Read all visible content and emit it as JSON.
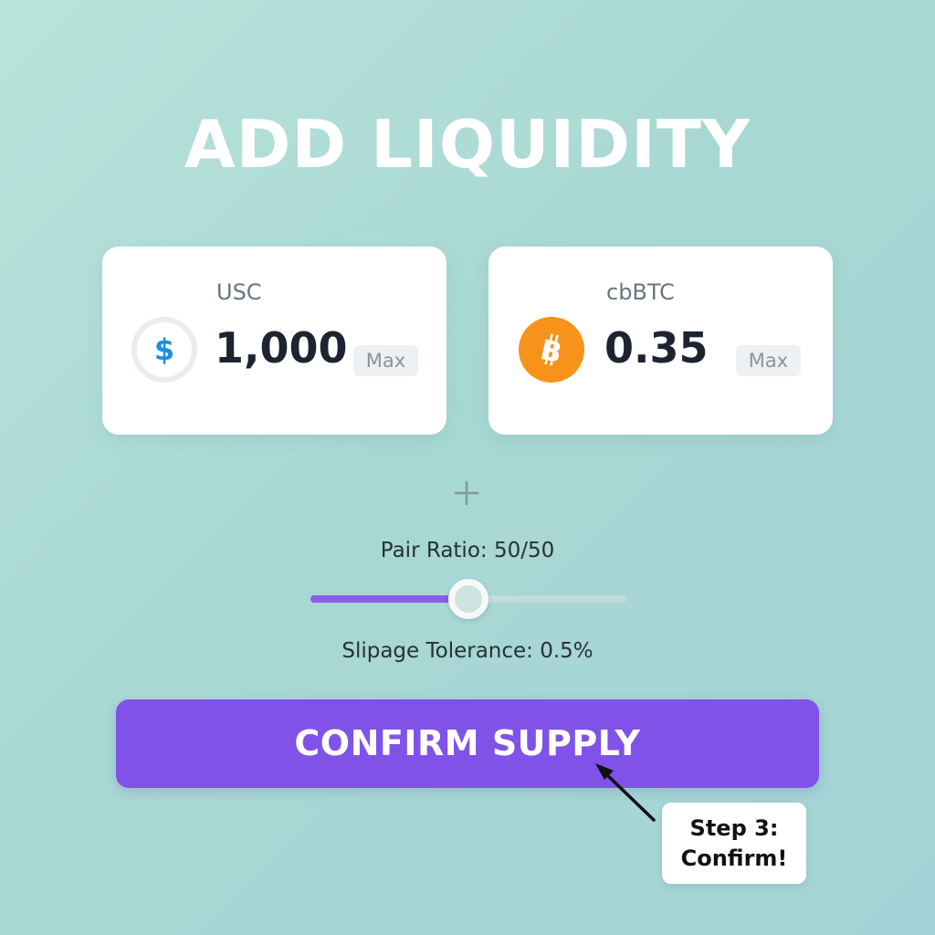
{
  "header": {
    "title": "ADD LIQUIDITY"
  },
  "tokens": [
    {
      "name": "USC",
      "amount": "1,000",
      "max_label": "Max",
      "icon": "dollar-coin-icon",
      "icon_color": "#1a8fe0"
    },
    {
      "name": "cbBTC",
      "amount": "0.35",
      "max_label": "Max",
      "icon": "bitcoin-icon",
      "icon_color": "#f7931a"
    }
  ],
  "separator_icon": "plus-icon",
  "pair_ratio": {
    "label": "Pair Ratio: 50/50",
    "slider_value": 0.5
  },
  "slippage": {
    "label": "Slipage Tolerance: 0.5%"
  },
  "confirm": {
    "label": "CONFIRM SUPPLY"
  },
  "callout": {
    "text": "Step 3:\nConfirm!"
  },
  "colors": {
    "accent": "#8052e8",
    "background": "#a9d8d4",
    "bitcoin": "#f7931a",
    "dollar": "#1a8fe0"
  }
}
